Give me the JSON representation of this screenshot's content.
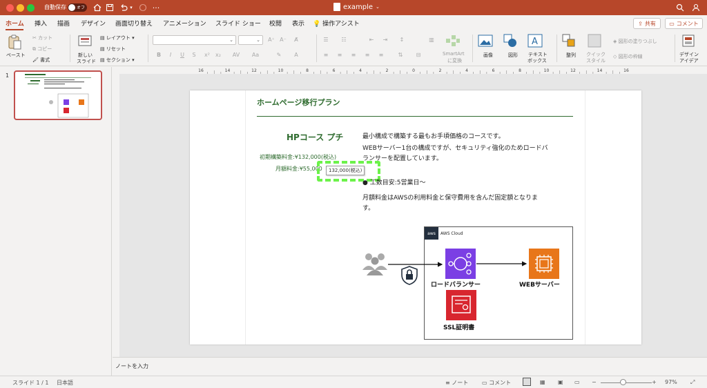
{
  "titlebar": {
    "autosave_label": "自動保存",
    "toggle_state": "オフ",
    "doc_name": "example"
  },
  "tabs": [
    "ホーム",
    "挿入",
    "描画",
    "デザイン",
    "画面切り替え",
    "アニメーション",
    "スライド ショー",
    "校閲",
    "表示",
    "操作アシスト"
  ],
  "share_label": "共有",
  "comment_label": "コメント",
  "ribbon": {
    "paste": "ペースト",
    "cut": "カット",
    "copy": "コピー",
    "format": "書式",
    "new_slide": "新しい\nスライド",
    "new_slide_l1": "新しい",
    "new_slide_l2": "スライド",
    "layout": "レイアウト",
    "reset": "リセット",
    "section": "セクション",
    "smartart_l1": "SmartArt",
    "smartart_l2": "に変換",
    "image": "画像",
    "shape": "図形",
    "textbox_l1": "テキスト",
    "textbox_l2": "ボックス",
    "arrange": "整列",
    "quickstyle_l1": "クイック",
    "quickstyle_l2": "スタイル",
    "shape_fill": "図形の塗りつぶし",
    "shape_outline": "図形の枠線",
    "design_ideas_l1": "デザイン",
    "design_ideas_l2": "アイデア"
  },
  "ruler_ticks": [
    "16",
    "14",
    "12",
    "10",
    "8",
    "6",
    "4",
    "2",
    "0",
    "2",
    "4",
    "6",
    "8",
    "10",
    "12",
    "14",
    "16"
  ],
  "thumbnail": {
    "slide_number": "1"
  },
  "slide": {
    "title": "ホームページ移行プラン",
    "course": "HPコース プチ",
    "initial_fee": "初期構築料金:¥132,000(税込)",
    "monthly_fee": "月額料金:¥55,000",
    "tooltip": "132,000(税込)",
    "body": [
      "最小構成で構築する最もお手頃価格のコースです。",
      "WEBサーバー1台の構成ですが、セキュリティ強化のためロードバ",
      "ランサーを配置しています。",
      "● 工数目安:5営業日〜",
      "月額料金はAWSの利用料金と保守費用を含んだ固定額となりま",
      "す。"
    ],
    "diagram": {
      "cloud_logo": "aws",
      "cloud_label": "AWS Cloud",
      "lb_label": "ロードバランサー",
      "web_label": "WEBサーバー",
      "ssl_label": "SSL証明書",
      "colors": {
        "lb": "#7b3fe4",
        "web": "#e8761a",
        "ssl": "#d8262f"
      }
    }
  },
  "notes_placeholder": "ノートを入力",
  "status": {
    "slide_count": "スライド 1 / 1",
    "language": "日本語",
    "notes": "ノート",
    "comments": "コメント",
    "zoom": "97%"
  }
}
